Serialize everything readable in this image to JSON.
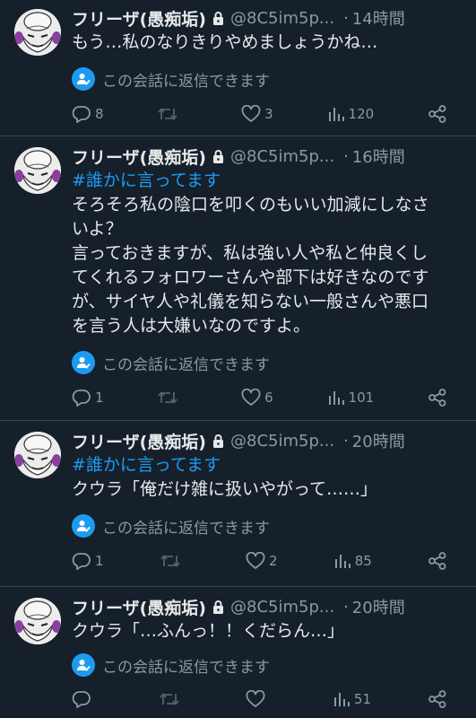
{
  "tweets": [
    {
      "name": "フリーザ(愚痴垢)",
      "handle": "@8C5im5p...",
      "dot": "·",
      "time": "14時間",
      "hashtag": "",
      "lines": [
        "もう…私のなりきりやめましょうかね…"
      ],
      "reply_note": "この会話に返信できます",
      "replies": "8",
      "retweets": "",
      "likes": "3",
      "views": "120"
    },
    {
      "name": "フリーザ(愚痴垢)",
      "handle": "@8C5im5p...",
      "dot": "·",
      "time": "16時間",
      "hashtag": "#誰かに言ってます",
      "lines": [
        "そろそろ私の陰口を叩くのもいい加減にしなさ",
        "いよ？",
        "言っておきますが、私は強い人や私と仲良くし",
        "てくれるフォロワーさんや部下は好きなのです",
        "が、サイヤ人や礼儀を知らない一般さんや悪口",
        "を言う人は大嫌いなのですよ。"
      ],
      "reply_note": "この会話に返信できます",
      "replies": "1",
      "retweets": "",
      "likes": "6",
      "views": "101"
    },
    {
      "name": "フリーザ(愚痴垢)",
      "handle": "@8C5im5p...",
      "dot": "·",
      "time": "20時間",
      "hashtag": "#誰かに言ってます",
      "lines": [
        "クウラ「俺だけ雑に扱いやがって……」"
      ],
      "reply_note": "この会話に返信できます",
      "replies": "1",
      "retweets": "",
      "likes": "2",
      "views": "85"
    },
    {
      "name": "フリーザ(愚痴垢)",
      "handle": "@8C5im5p...",
      "dot": "·",
      "time": "20時間",
      "hashtag": "",
      "lines": [
        "クウラ「…ふんっ！！くだらん…」"
      ],
      "reply_note": "この会話に返信できます",
      "replies": "",
      "retweets": "",
      "likes": "",
      "views": "51"
    }
  ],
  "colors": {
    "background": "#15202b",
    "accent": "#1d9bf0",
    "muted": "#8b98a5",
    "divider": "#38444d"
  },
  "icons": [
    "lock-icon",
    "reply-restricted-icon",
    "reply-icon",
    "retweet-icon",
    "like-icon",
    "views-icon",
    "share-icon"
  ]
}
